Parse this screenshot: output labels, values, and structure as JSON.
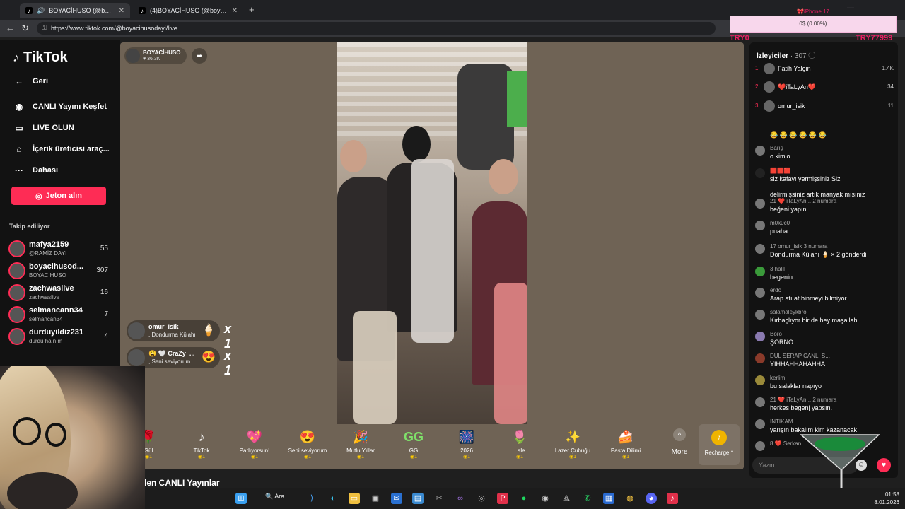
{
  "browser": {
    "tabs": [
      {
        "label": "BOYACİHUSO (@boyacihuso...",
        "active": true
      },
      {
        "label": "(4)BOYACİHUSO (@boyacihuso...",
        "active": false
      }
    ],
    "url": "https://www.tiktok.com/@boyacihusodayi/live"
  },
  "overlay": {
    "goal_title": "iPhone 17",
    "goal_progress": "0$ (0.00%)",
    "left_code": "TRY0",
    "right_code": "TRY77999"
  },
  "sidebar": {
    "logo": "TikTok",
    "nav": [
      {
        "label": "Geri",
        "icon": "back-arrow-icon"
      },
      {
        "label": "CANLI Yayını Keşfet",
        "icon": "live-explore-icon"
      },
      {
        "label": "LIVE OLUN",
        "icon": "camera-icon"
      },
      {
        "label": "İçerik üreticisi araç...",
        "icon": "home-icon"
      },
      {
        "label": "Dahası",
        "icon": "more-dots-icon"
      }
    ],
    "coin_button": "Jeton alın",
    "following_title": "Takip ediliyor",
    "following": [
      {
        "name": "mafya2159",
        "sub": "@RAMİZ DAYI",
        "count": "55"
      },
      {
        "name": "boyacihusod...",
        "sub": "BOYACİHUSO",
        "count": "307"
      },
      {
        "name": "zachwaslive",
        "sub": "zachwaslive",
        "count": "16"
      },
      {
        "name": "selmancann34",
        "sub": "selmancan34",
        "count": "7"
      },
      {
        "name": "durduyildiz231",
        "sub": "durdu ha nım",
        "count": "4"
      }
    ]
  },
  "stream": {
    "host_name": "BOYACİHUSO",
    "host_likes": "♥ 36.3K",
    "gift_notes": [
      {
        "user": "omur_isik",
        "gift": ", Dondurma Külahı",
        "mult": "x 1",
        "icon": "🍦"
      },
      {
        "user": "😩 🤍 CraZy_...",
        "gift": ", Seni seviyorum...",
        "mult": "x 1",
        "icon": "😍"
      }
    ],
    "gifts": [
      {
        "name": "Gül",
        "price": "◉1",
        "icon": "🌹"
      },
      {
        "name": "TikTok",
        "price": "◉1",
        "icon": "♪"
      },
      {
        "name": "Parlıyorsun!",
        "price": "◉1",
        "icon": "💖"
      },
      {
        "name": "Seni seviyorum",
        "price": "◉1",
        "icon": "😍"
      },
      {
        "name": "Mutlu Yıllar",
        "price": "◉1",
        "icon": "🎉"
      },
      {
        "name": "GG",
        "price": "◉1",
        "icon": "GG"
      },
      {
        "name": "2026",
        "price": "◉1",
        "icon": "🎆"
      },
      {
        "name": "Lale",
        "price": "◉1",
        "icon": "🌷"
      },
      {
        "name": "Lazer Çubuğu",
        "price": "◉1",
        "icon": "✨"
      },
      {
        "name": "Pasta Dilimi",
        "price": "◉1",
        "icon": "🍰"
      }
    ],
    "more_label": "More",
    "recharge_label": "Recharge ^",
    "bottom_heading": "len CANLI Yayınlar"
  },
  "viewers": {
    "title": "İzleyiciler",
    "count": "· 307",
    "top": [
      {
        "rank": "1",
        "name": "Fatih Yalçın",
        "score": "1.4K"
      },
      {
        "rank": "2",
        "name": "❤️iTaLyAn❤️",
        "score": "34"
      },
      {
        "rank": "3",
        "name": "omur_isik",
        "score": "11"
      }
    ]
  },
  "chat": [
    {
      "name": "",
      "msg": "😂 😂 😂 😂 😂 😂"
    },
    {
      "name": "Barış",
      "msg": "o kimlo"
    },
    {
      "name": "🟥🟥🟥",
      "msg": "siz kafayı yermişsiniz Siz"
    },
    {
      "name": "",
      "msg": "delirmişsiniz artık manyak mısınız"
    },
    {
      "name": "21 ❤️ iTaLyAn... 2 numara",
      "msg": "beğeni yapın"
    },
    {
      "name": "m0k0c0",
      "msg": "puaha"
    },
    {
      "name": "17 omur_isik 3 numara",
      "msg": "Dondurma Külahı 🍦 × 2 gönderdi"
    },
    {
      "name": "3 halil",
      "msg": "begenin"
    },
    {
      "name": "erdo",
      "msg": "Arap atı at binmeyi bilmiyor"
    },
    {
      "name": "salamaleykbro",
      "msg": "Kırbaçlıyor bir de hey maşallah"
    },
    {
      "name": "Boro",
      "msg": "ŞORNO"
    },
    {
      "name": "DUL SERAP CANLI S...",
      "msg": "YİHHAHHAHAHHA"
    },
    {
      "name": "kerlim",
      "msg": "bu salaklar napıyo"
    },
    {
      "name": "21 ❤️ iTaLyAn... 2 numara",
      "msg": "herkes begenj yapsın."
    },
    {
      "name": "İNTİKAM",
      "msg": "yarışın bakalım kim kazanacak"
    },
    {
      "name": "8 ❤️ Serkan",
      "msg": ""
    }
  ],
  "chat_input_placeholder": "Yazın...",
  "taskbar": {
    "search": "Ara",
    "time": "01:58",
    "date": "8.01.2026"
  }
}
